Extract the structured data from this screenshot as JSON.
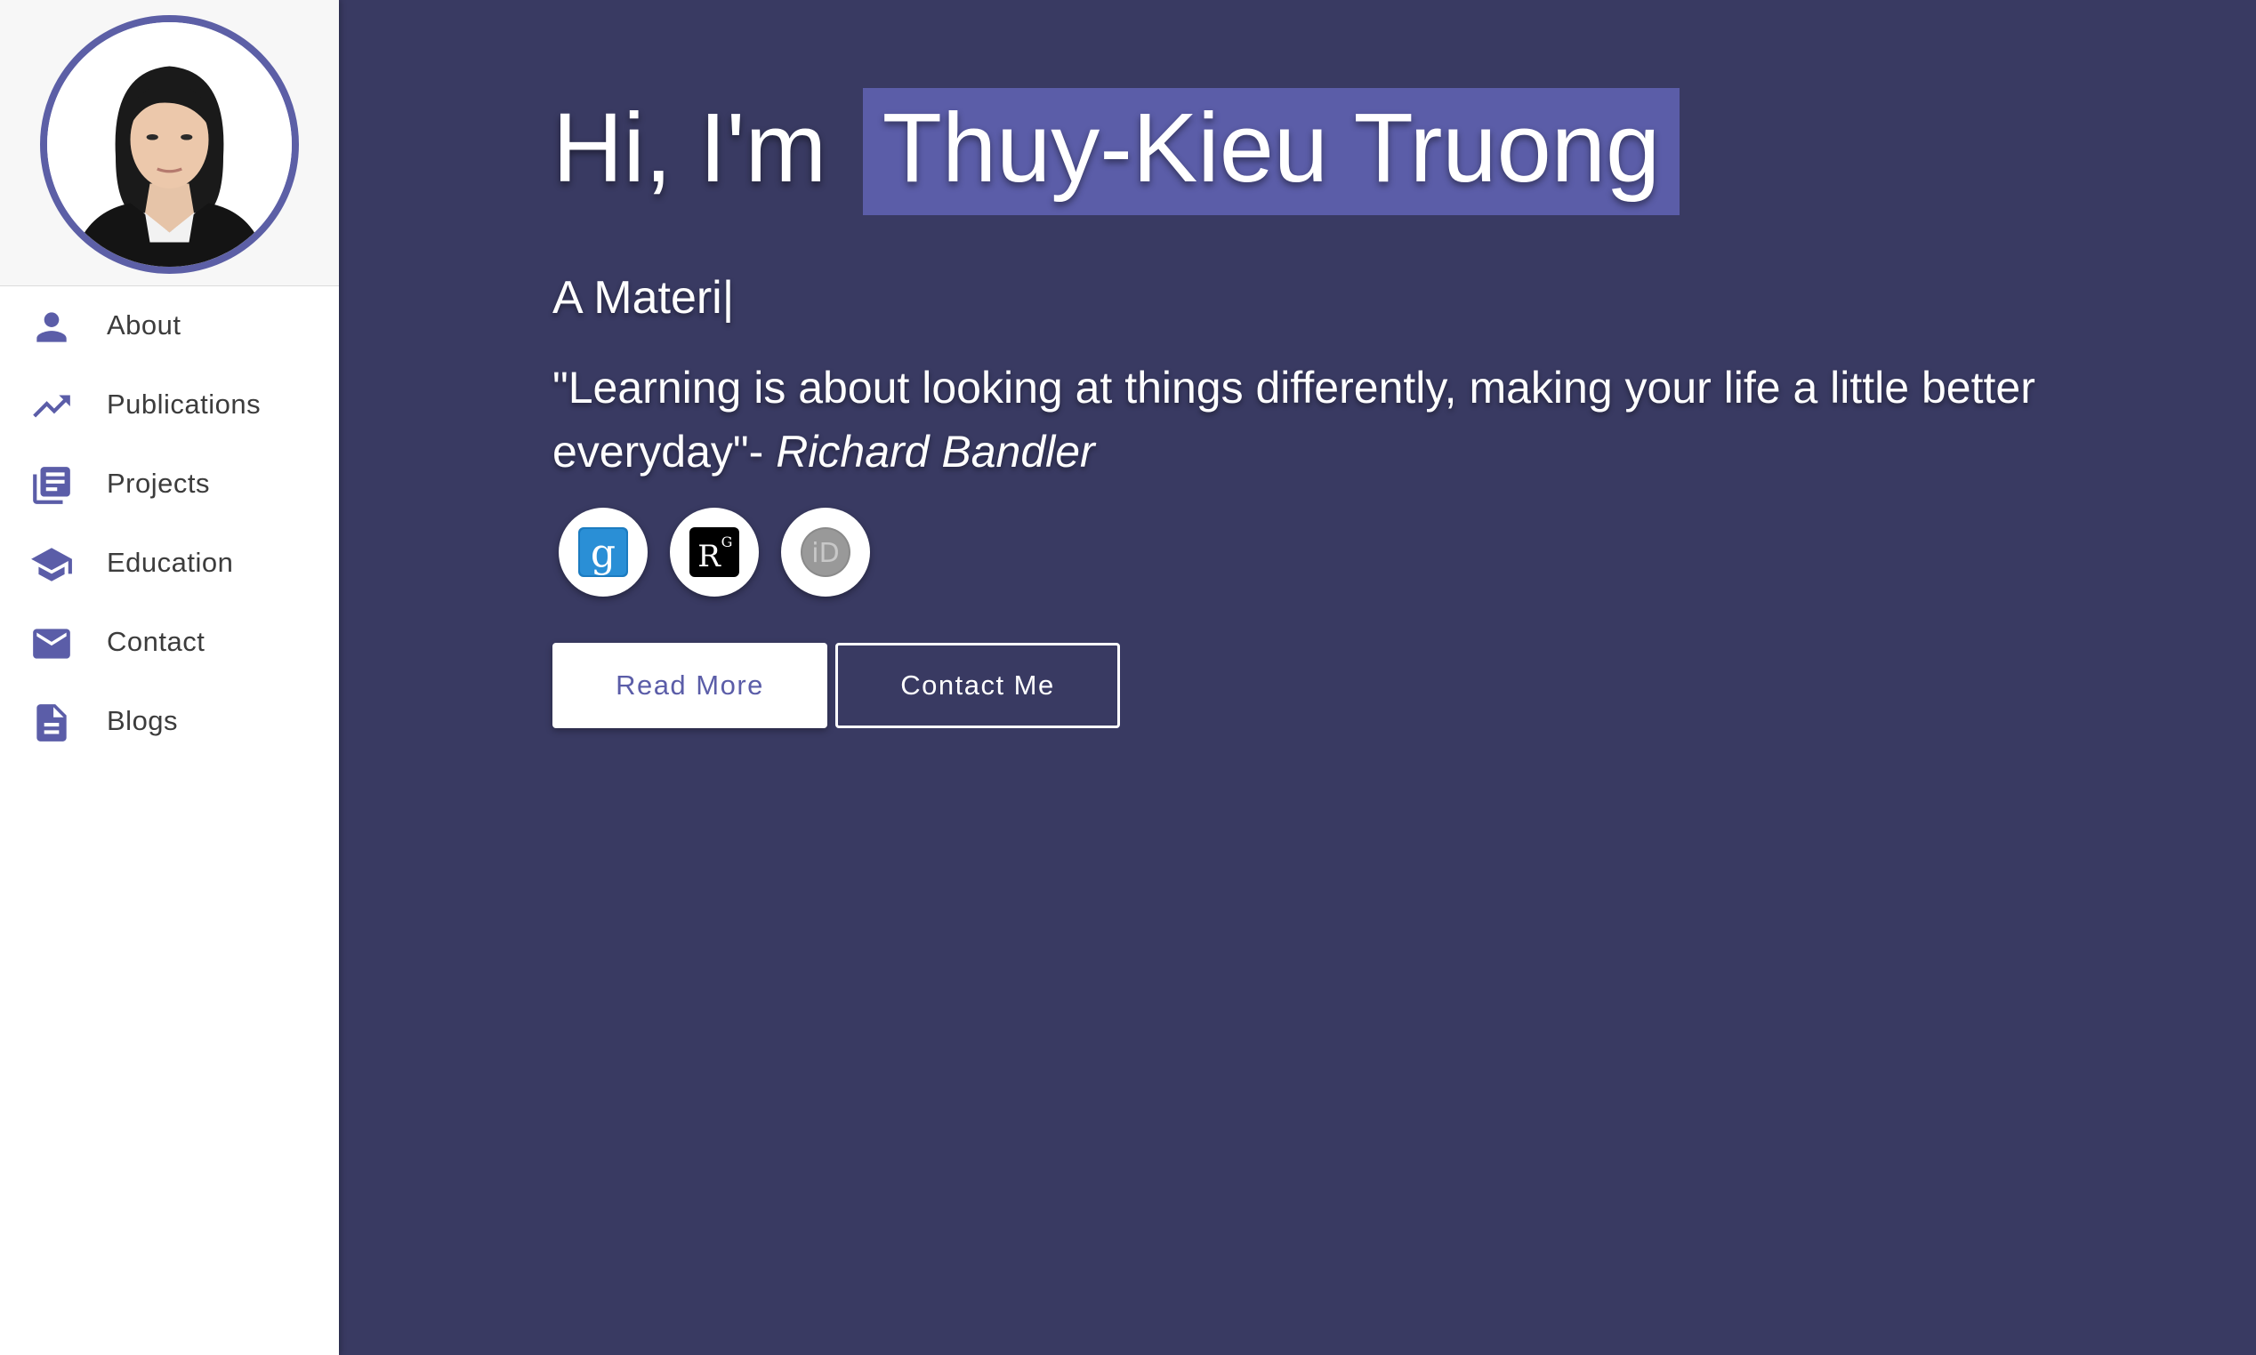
{
  "colors": {
    "accent": "#5b5da8",
    "main_bg": "#393a62",
    "sidebar_bg": "#ffffff"
  },
  "sidebar": {
    "items": [
      {
        "label": "About",
        "icon": "person-icon"
      },
      {
        "label": "Publications",
        "icon": "trending-up-icon"
      },
      {
        "label": "Projects",
        "icon": "library-books-icon"
      },
      {
        "label": "Education",
        "icon": "graduation-cap-icon"
      },
      {
        "label": "Contact",
        "icon": "mail-icon"
      },
      {
        "label": "Blogs",
        "icon": "document-icon"
      }
    ]
  },
  "hero": {
    "greeting": "Hi, I'm",
    "name": "Thuy-Kieu Truong",
    "typed_text": "A Materi",
    "cursor": "|",
    "quote_text": "\"Learning is about looking at things differently, making your life a little better everyday\"-",
    "quote_author": "Richard Bandler"
  },
  "socials": [
    {
      "icon": "google-scholar-icon"
    },
    {
      "icon": "researchgate-icon"
    },
    {
      "icon": "orcid-icon"
    }
  ],
  "buttons": {
    "read_more": "Read More",
    "contact_me": "Contact Me"
  }
}
